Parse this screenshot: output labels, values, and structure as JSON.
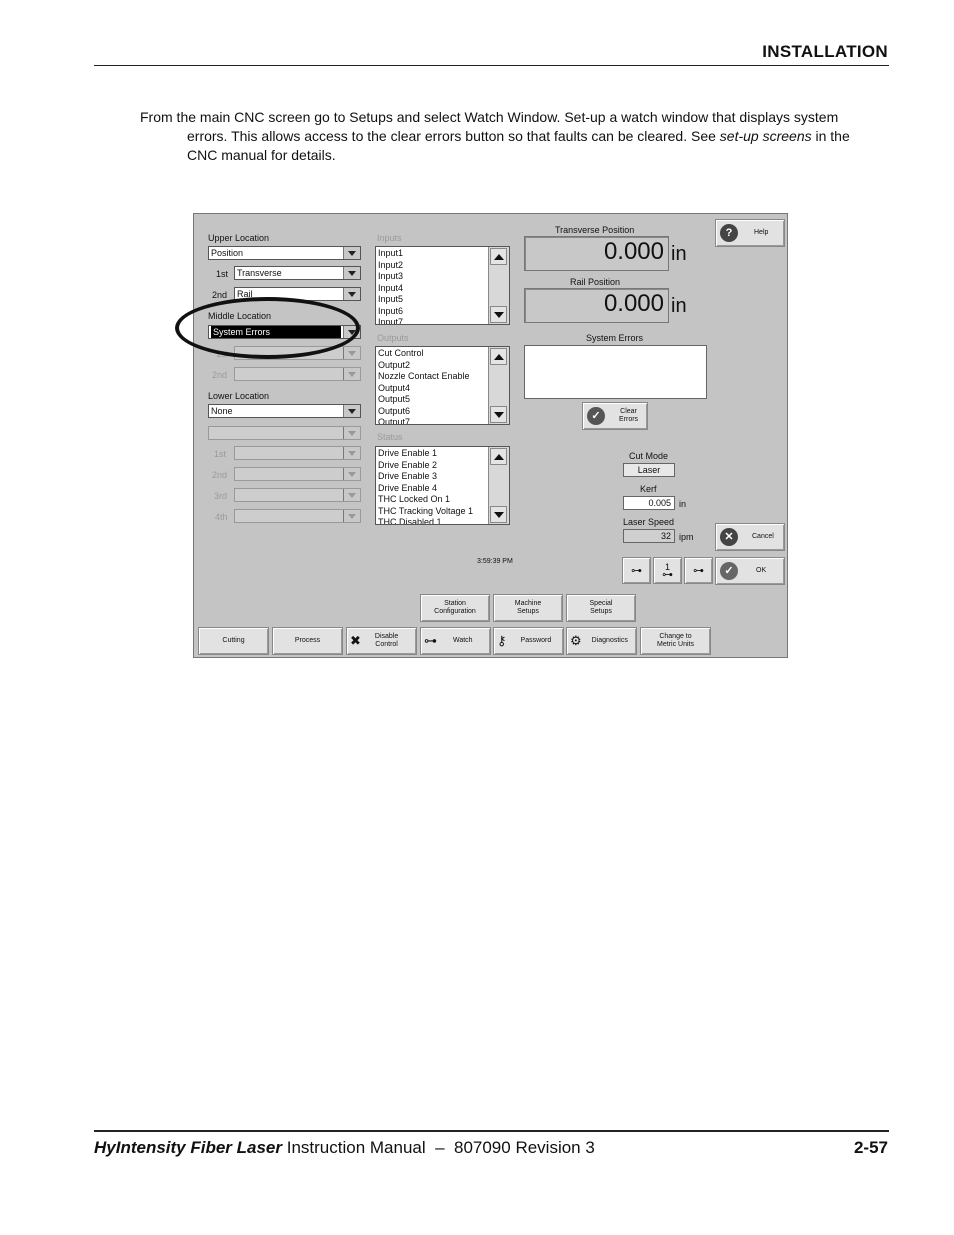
{
  "header": {
    "section": "INSTALLATION"
  },
  "intro": {
    "text_before": "From the main CNC screen go to Setups and select Watch Window. Set-up a watch window that displays system errors. This allows access to the clear errors button so that faults can be cleared. See ",
    "italic": "set-up screens",
    "text_after": " in the CNC manual for details."
  },
  "cnc": {
    "upper_location": {
      "label": "Upper Location",
      "value": "Position",
      "first_label": "1st",
      "first_value": "Transverse",
      "second_label": "2nd",
      "second_value": "Rail"
    },
    "middle_location": {
      "label": "Middle Location",
      "value": "System Errors",
      "first_label": "1st",
      "second_label": "2nd"
    },
    "lower_location": {
      "label": "Lower Location",
      "value": "None",
      "labels": [
        "1st",
        "2nd",
        "3rd",
        "4th"
      ]
    },
    "inputs": {
      "title": "Inputs",
      "items": [
        "Input1",
        "Input2",
        "Input3",
        "Input4",
        "Input5",
        "Input6",
        "Input7"
      ]
    },
    "outputs": {
      "title": "Outputs",
      "items": [
        "Cut Control",
        "Output2",
        "Nozzle Contact Enable",
        "Output4",
        "Output5",
        "Output6",
        "Output7"
      ]
    },
    "status": {
      "title": "Status",
      "items": [
        "Drive Enable 1",
        "Drive Enable 2",
        "Drive Enable 3",
        "Drive Enable 4",
        "THC Locked On 1",
        "THC Tracking Voltage 1",
        "THC Disabled 1"
      ]
    },
    "transverse": {
      "label": "Transverse Position",
      "value": "0.000",
      "unit": "in"
    },
    "rail": {
      "label": "Rail Position",
      "value": "0.000",
      "unit": "in"
    },
    "system_errors": {
      "label": "System Errors"
    },
    "clear_errors": {
      "label1": "Clear",
      "label2": "Errors"
    },
    "cut_mode": {
      "label": "Cut Mode",
      "value": "Laser"
    },
    "kerf": {
      "label": "Kerf",
      "value": "0.005",
      "unit": "in"
    },
    "laser_speed": {
      "label": "Laser Speed",
      "value": "32",
      "unit": "ipm"
    },
    "time": "3:59:39 PM",
    "help": "Help",
    "cancel": "Cancel",
    "ok": "OK",
    "watch_icon_number": "1",
    "setup_buttons": [
      {
        "l1": "Station",
        "l2": "Configuration"
      },
      {
        "l1": "Machine",
        "l2": "Setups"
      },
      {
        "l1": "Special",
        "l2": "Setups"
      }
    ],
    "nav_buttons": [
      {
        "l1": "Cutting",
        "l2": ""
      },
      {
        "l1": "Process",
        "l2": ""
      },
      {
        "l1": "Disable",
        "l2": "Control"
      },
      {
        "l1": "Watch",
        "l2": ""
      },
      {
        "l1": "Password",
        "l2": ""
      },
      {
        "l1": "Diagnostics",
        "l2": ""
      },
      {
        "l1": "Change to",
        "l2": "Metric Units"
      }
    ]
  },
  "footer": {
    "product": "HyIntensity Fiber Laser",
    "manual": " Instruction Manual  –  807090 Revision 3",
    "page": "2-57"
  }
}
